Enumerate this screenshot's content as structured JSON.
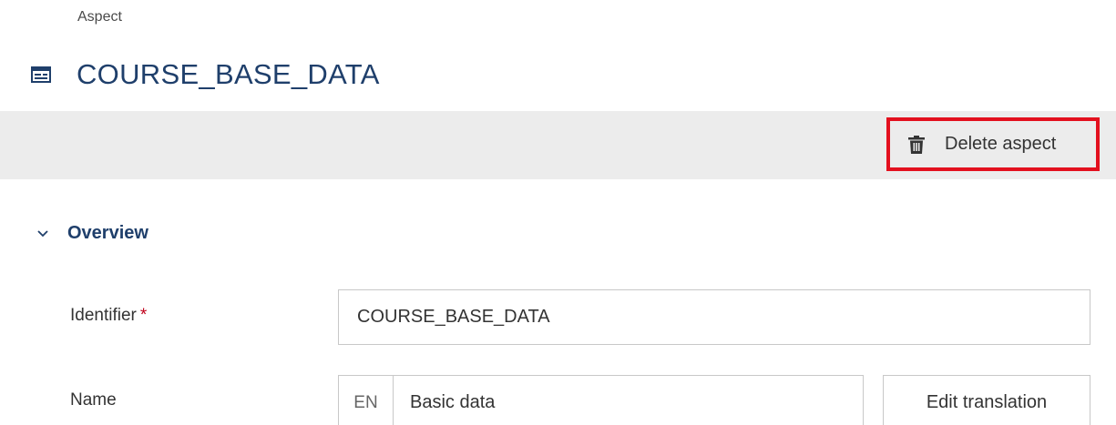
{
  "breadcrumb": "Aspect",
  "header": {
    "title": "COURSE_BASE_DATA",
    "icon": "aspect-card-icon"
  },
  "toolbar": {
    "delete_label": "Delete aspect",
    "delete_icon": "trash-icon",
    "highlight_color": "#e3101e"
  },
  "section": {
    "title": "Overview",
    "expanded": true
  },
  "fields": {
    "identifier": {
      "label": "Identifier",
      "required_mark": "*",
      "value": "COURSE_BASE_DATA"
    },
    "name": {
      "label": "Name",
      "language": "EN",
      "value": "Basic data",
      "edit_label": "Edit translation"
    }
  },
  "colors": {
    "title": "#1f3f6b",
    "toolbar_bg": "#ececec"
  }
}
